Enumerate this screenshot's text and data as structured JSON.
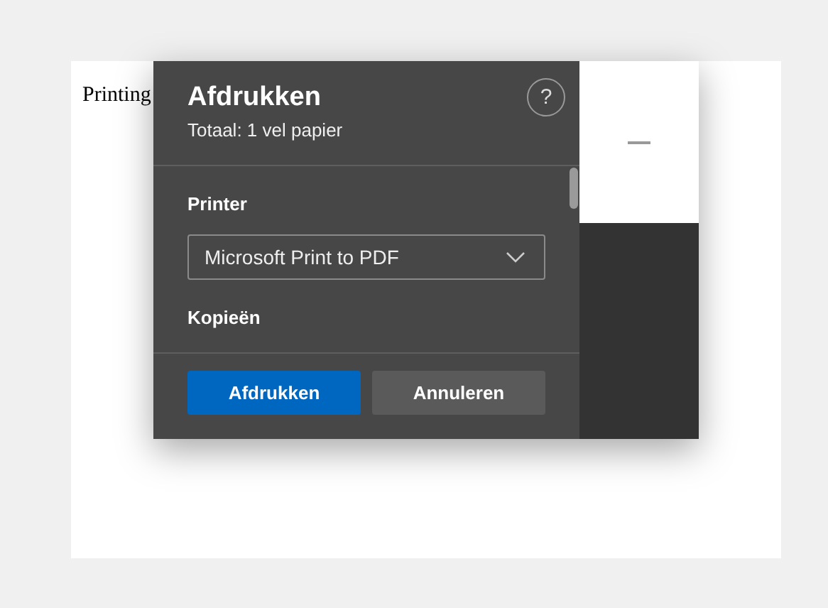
{
  "document": {
    "text": "Printing"
  },
  "dialog": {
    "title": "Afdrukken",
    "subtitle": "Totaal: 1 vel papier",
    "sections": [
      {
        "kind": "select",
        "label": "Printer",
        "value": "Microsoft Print to PDF"
      },
      {
        "kind": "heading",
        "label": "Kopieën"
      }
    ],
    "buttons": [
      {
        "label": "Afdrukken",
        "kind": "primary"
      },
      {
        "label": "Annuleren",
        "kind": "secondary"
      }
    ],
    "help": "?"
  }
}
